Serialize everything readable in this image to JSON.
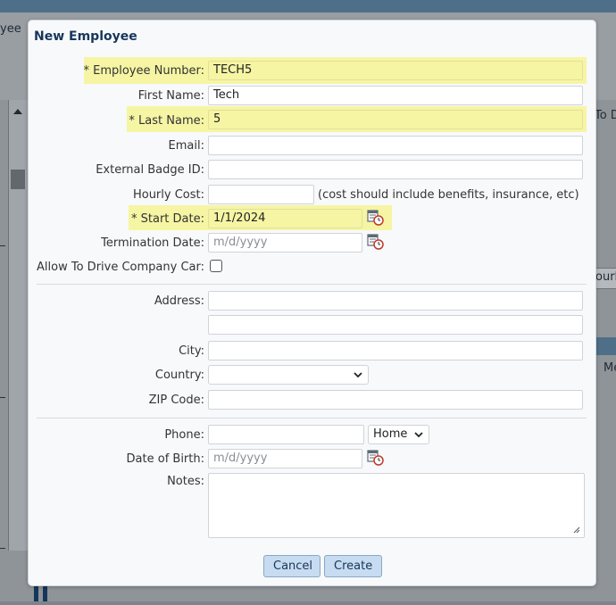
{
  "background": {
    "snippet_top_left": "yee",
    "snippet_right_1": "To D",
    "snippet_right_2": "ourly",
    "snippet_right_3": "Me"
  },
  "dialog": {
    "title": "New Employee",
    "fields": {
      "employee_number": {
        "label": "* Employee Number:",
        "value": "TECH5"
      },
      "first_name": {
        "label": "First Name:",
        "value": "Tech"
      },
      "last_name": {
        "label": "* Last Name:",
        "value": "5"
      },
      "email": {
        "label": "Email:",
        "value": ""
      },
      "external_badge_id": {
        "label": "External Badge ID:",
        "value": ""
      },
      "hourly_cost": {
        "label": "Hourly Cost:",
        "value": "",
        "hint": "(cost should include benefits, insurance, etc)"
      },
      "start_date": {
        "label": "* Start Date:",
        "value": "1/1/2024"
      },
      "termination_date": {
        "label": "Termination Date:",
        "placeholder": "m/d/yyyy"
      },
      "allow_drive": {
        "label": "Allow To Drive Company Car:",
        "checked": false
      },
      "address": {
        "label": "Address:",
        "line1": "",
        "line2": ""
      },
      "city": {
        "label": "City:",
        "value": ""
      },
      "country": {
        "label": "Country:",
        "value": ""
      },
      "zip": {
        "label": "ZIP Code:",
        "value": ""
      },
      "phone": {
        "label": "Phone:",
        "value": "",
        "type": "Home"
      },
      "date_of_birth": {
        "label": "Date of Birth:",
        "placeholder": "m/d/yyyy"
      },
      "notes": {
        "label": "Notes:",
        "value": ""
      }
    },
    "buttons": {
      "cancel": "Cancel",
      "create": "Create"
    },
    "icons": {
      "calendar": "calendar-clock-icon",
      "chevron": "chevron-down-icon",
      "resize": "resize-grip-icon"
    },
    "colors": {
      "required_highlight": "#f6f5a4",
      "title": "#17365b",
      "button_bg": "#c7dcf0"
    }
  }
}
